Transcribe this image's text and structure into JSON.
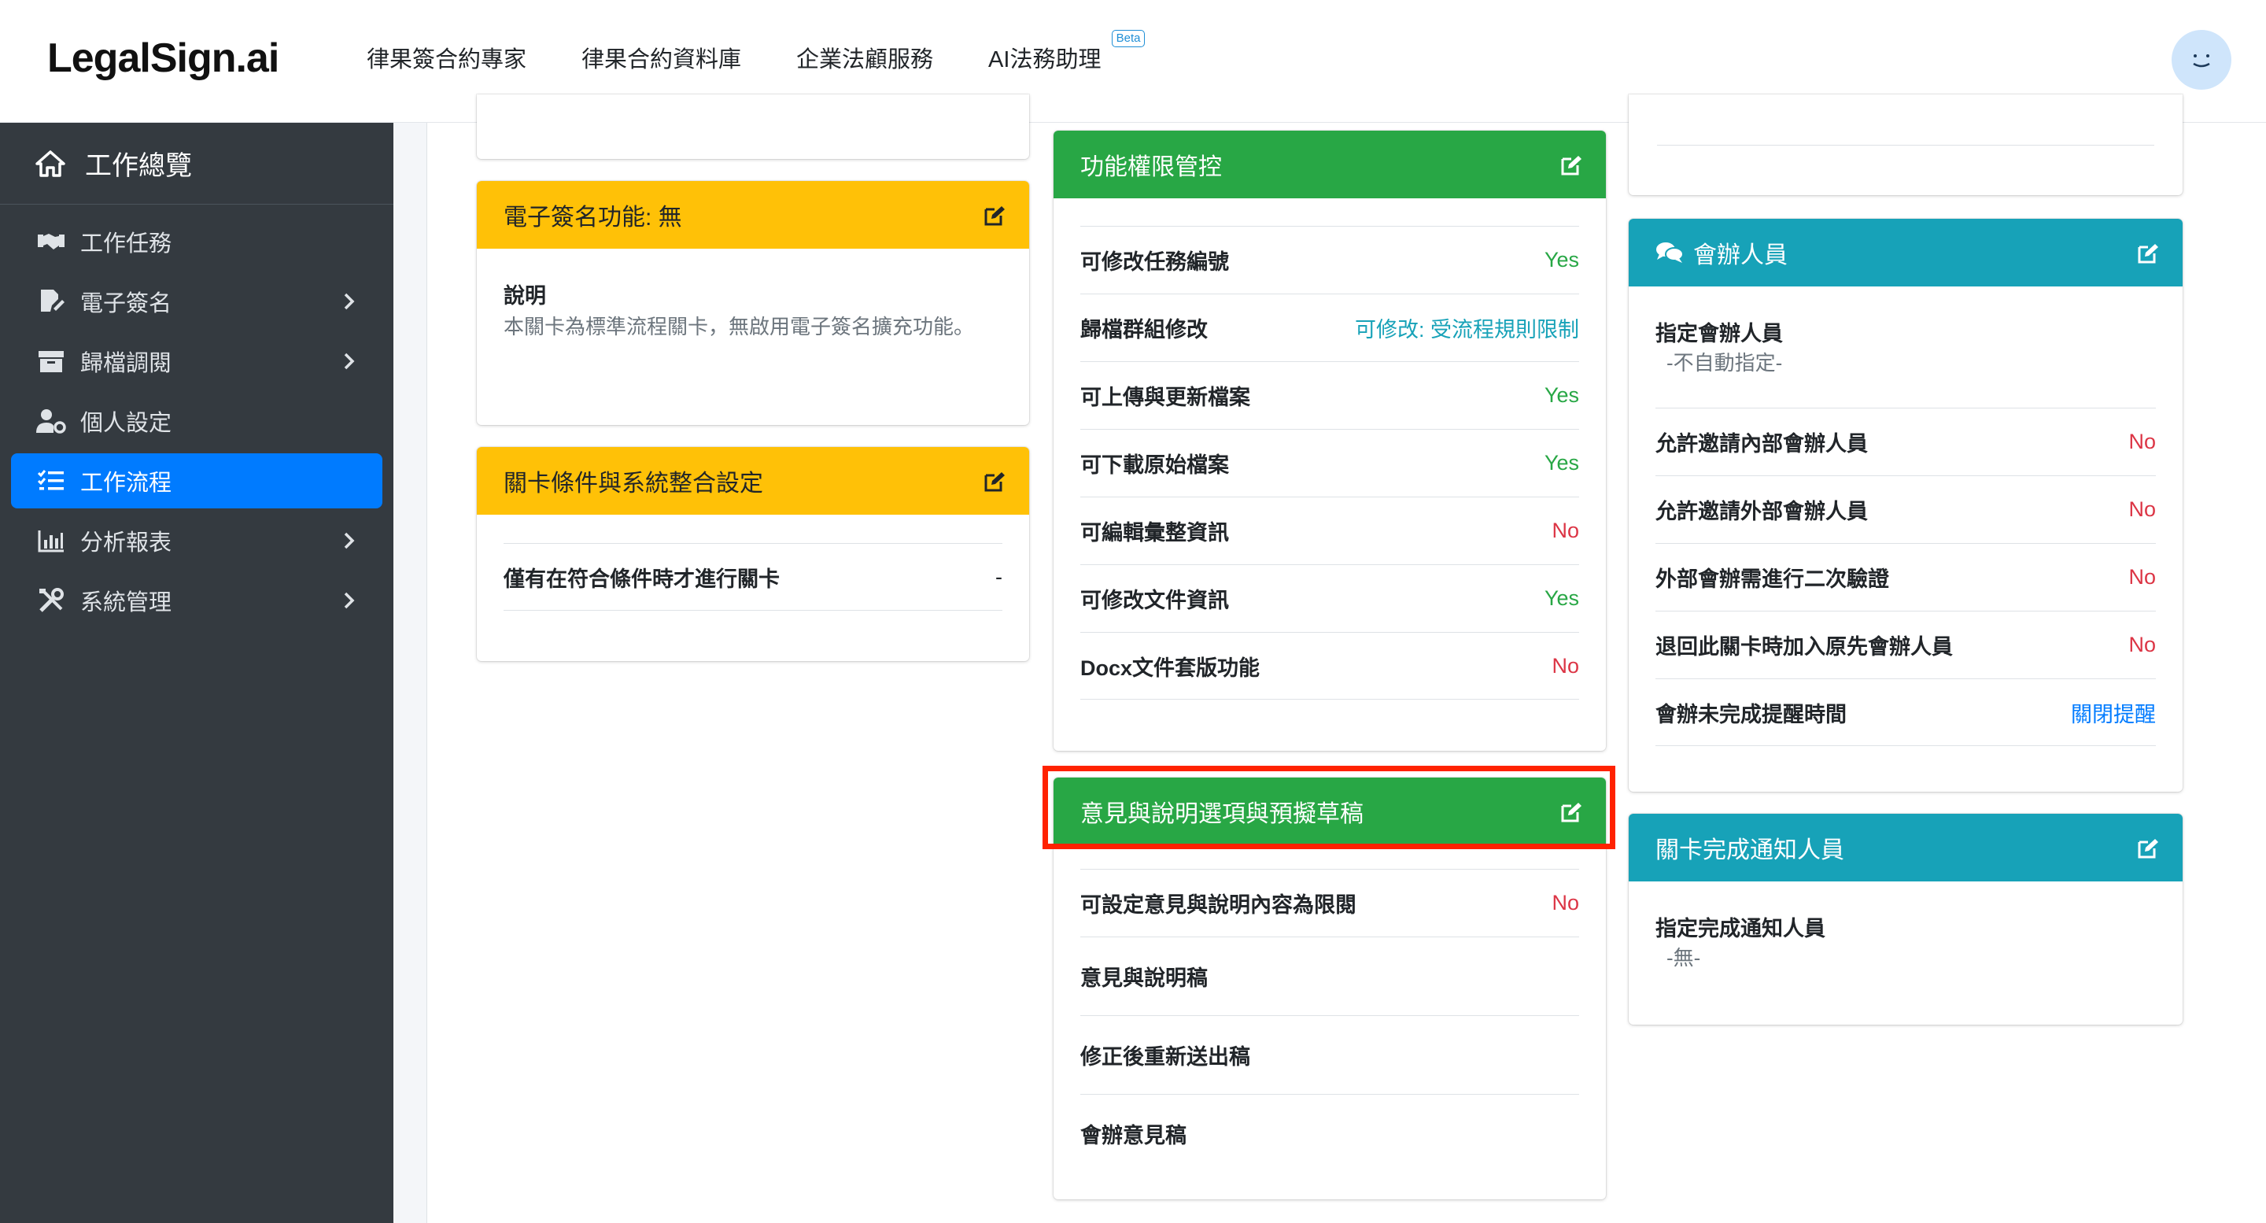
{
  "header": {
    "logo": "LegalSign.ai",
    "nav": [
      "律果簽合約專家",
      "律果合約資料庫",
      "企業法顧服務",
      "AI法務助理"
    ],
    "beta_label": "Beta",
    "avatar_icon": "smiley-face-icon"
  },
  "sidebar": {
    "title": "工作總覽",
    "items": [
      {
        "label": "工作任務",
        "icon": "handshake-icon",
        "expandable": false
      },
      {
        "label": "電子簽名",
        "icon": "signature-icon",
        "expandable": true
      },
      {
        "label": "歸檔調閱",
        "icon": "archive-icon",
        "expandable": true
      },
      {
        "label": "個人設定",
        "icon": "user-cog-icon",
        "expandable": false
      },
      {
        "label": "工作流程",
        "icon": "tasks-icon",
        "expandable": false,
        "active": true
      },
      {
        "label": "分析報表",
        "icon": "chart-icon",
        "expandable": true
      },
      {
        "label": "系統管理",
        "icon": "tools-icon",
        "expandable": true
      }
    ]
  },
  "cards": {
    "esign": {
      "title": "電子簽名功能: 無",
      "desc_title": "說明",
      "desc_text": "本關卡為標準流程關卡，無啟用電子簽名擴充功能。"
    },
    "conditions": {
      "title": "關卡條件與系統整合設定",
      "row_label": "僅有在符合條件時才進行關卡",
      "row_value": "-"
    },
    "permissions": {
      "title": "功能權限管控",
      "rows": [
        {
          "label": "可修改任務編號",
          "value": "Yes"
        },
        {
          "label": "歸檔群組修改",
          "value": "可修改: 受流程規則限制"
        },
        {
          "label": "可上傳與更新檔案",
          "value": "Yes"
        },
        {
          "label": "可下載原始檔案",
          "value": "Yes"
        },
        {
          "label": "可編輯彙整資訊",
          "value": "No"
        },
        {
          "label": "可修改文件資訊",
          "value": "Yes"
        },
        {
          "label": "Docx文件套版功能",
          "value": "No"
        }
      ]
    },
    "opinions": {
      "title": "意見與說明選項與預擬草稿",
      "rows": [
        {
          "label": "可設定意見與說明內容為限閱",
          "value": "No"
        },
        {
          "label": "意見與說明稿",
          "value": ""
        },
        {
          "label": "修正後重新送出稿",
          "value": ""
        },
        {
          "label": "會辦意見稿",
          "value": ""
        }
      ]
    },
    "cosign": {
      "title": "會辦人員",
      "assign_title": "指定會辦人員",
      "assign_value": "-不自動指定-",
      "rows": [
        {
          "label": "允許邀請內部會辦人員",
          "value": "No"
        },
        {
          "label": "允許邀請外部會辦人員",
          "value": "No"
        },
        {
          "label": "外部會辦需進行二次驗證",
          "value": "No"
        },
        {
          "label": "退回此關卡時加入原先會辦人員",
          "value": "No"
        },
        {
          "label": "會辦未完成提醒時間",
          "value": "關閉提醒"
        }
      ]
    },
    "notify": {
      "title": "關卡完成通知人員",
      "assign_title": "指定完成通知人員",
      "assign_value": "-無-"
    }
  },
  "colors": {
    "yellow_header": "#ffc107",
    "green_header": "#28a745",
    "teal_header": "#17a2b8",
    "sidebar_bg": "#343a40",
    "active_item": "#007bff",
    "yes": "#28a745",
    "no": "#dc3545",
    "highlight_box": "#ff2200"
  }
}
